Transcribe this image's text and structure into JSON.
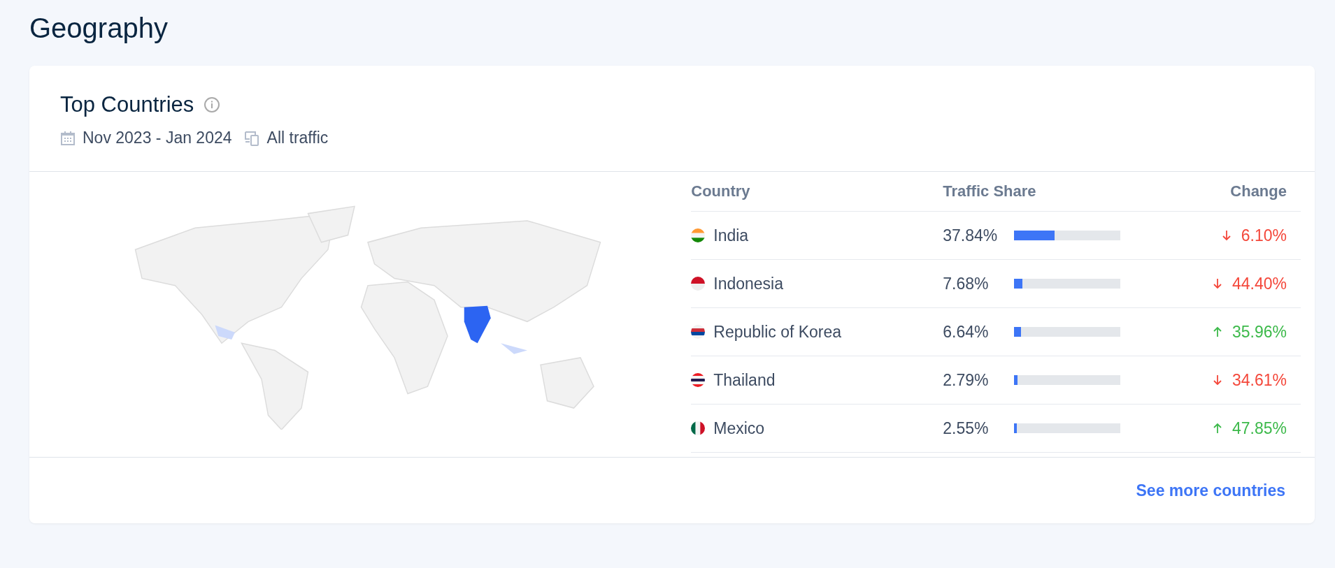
{
  "page_title": "Geography",
  "card": {
    "title": "Top Countries",
    "date_range": "Nov 2023 - Jan 2024",
    "traffic": "All traffic",
    "columns": [
      "Country",
      "Traffic Share",
      "Change"
    ],
    "rows": [
      {
        "kind": "india",
        "country": "India",
        "share": "37.84%",
        "level": 0.3784,
        "change": "6.10%",
        "increase": false
      },
      {
        "kind": "indonesia",
        "country": "Indonesia",
        "share": "7.68%",
        "level": 0.0768,
        "change": "44.40%",
        "increase": false
      },
      {
        "kind": "korea",
        "country": "Republic of Korea",
        "share": "6.64%",
        "level": 0.0664,
        "change": "35.96%",
        "increase": true
      },
      {
        "kind": "thailand",
        "country": "Thailand",
        "share": "2.79%",
        "level": 0.0279,
        "change": "34.61%",
        "increase": false
      },
      {
        "kind": "mexico",
        "country": "Mexico",
        "share": "2.55%",
        "level": 0.0255,
        "change": "47.85%",
        "increase": true
      }
    ],
    "link": "See more countries"
  }
}
